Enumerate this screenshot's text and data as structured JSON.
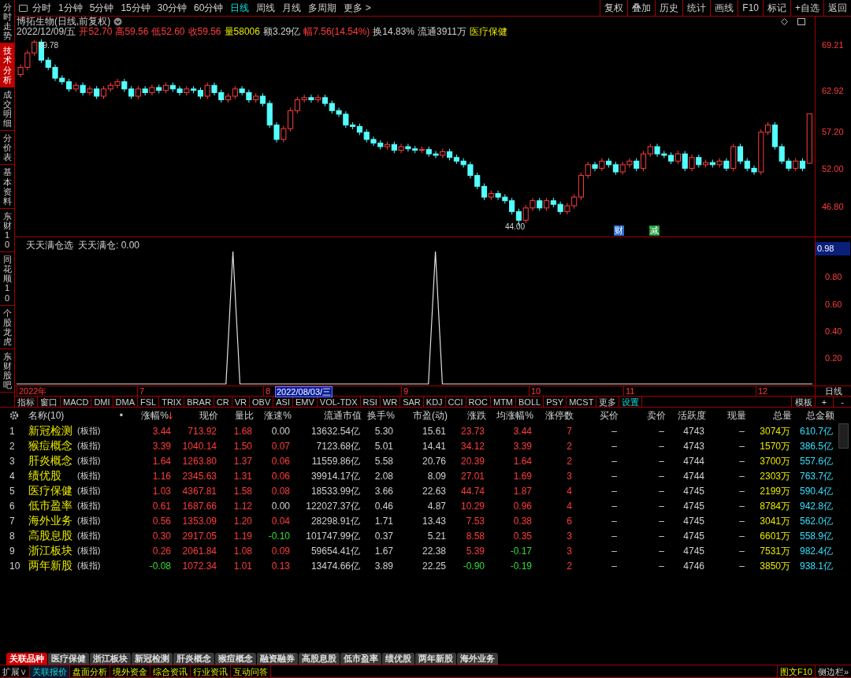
{
  "sidebar_tabs": [
    {
      "label": "分时走势",
      "selected": false
    },
    {
      "label": "技术分析",
      "selected": true
    },
    {
      "label": "成交明细",
      "selected": false
    },
    {
      "label": "分价表",
      "selected": false
    },
    {
      "label": "基本资料",
      "selected": false
    },
    {
      "label": "东财10",
      "selected": false
    },
    {
      "label": "同花顺10",
      "selected": false
    },
    {
      "label": "个股龙虎",
      "selected": false
    },
    {
      "label": "东财股吧",
      "selected": false
    }
  ],
  "periods": [
    {
      "label": "分时",
      "selected": false
    },
    {
      "label": "1分钟",
      "selected": false
    },
    {
      "label": "5分钟",
      "selected": false
    },
    {
      "label": "15分钟",
      "selected": false
    },
    {
      "label": "30分钟",
      "selected": false
    },
    {
      "label": "60分钟",
      "selected": false
    },
    {
      "label": "日线",
      "selected": true
    },
    {
      "label": "周线",
      "selected": false
    },
    {
      "label": "月线",
      "selected": false
    },
    {
      "label": "多周期",
      "selected": false
    }
  ],
  "more": "更多 >",
  "right_buttons": [
    "复权",
    "叠加",
    "历史",
    "统计",
    "画线",
    "F10",
    "标记",
    "+自选",
    "返回"
  ],
  "stock": {
    "title": "博拓生物(日线,前复权)",
    "info": [
      {
        "text": "2022/12/09/五",
        "kind": "plain"
      },
      {
        "text": "开52.70",
        "kind": "up"
      },
      {
        "text": "高59.56",
        "kind": "up"
      },
      {
        "text": "低52.60",
        "kind": "up"
      },
      {
        "text": "收59.56",
        "kind": "up"
      },
      {
        "text": "量58006",
        "kind": "volume"
      },
      {
        "text": "额3.29亿",
        "kind": "plain"
      },
      {
        "text": "幅7.56(14.54%)",
        "kind": "up"
      },
      {
        "text": "换14.83%",
        "kind": "plain"
      },
      {
        "text": "流通3911万",
        "kind": "plain"
      },
      {
        "text": "医疗保健",
        "kind": "volume"
      }
    ],
    "high_label": "69.78",
    "low_label": "44.00",
    "markers": [
      {
        "text": "财",
        "color": "#2f6fd0"
      },
      {
        "text": "减",
        "color": "#1f9a3a"
      }
    ],
    "chart_data": {
      "type": "candlestick",
      "yticks": [
        {
          "value": 69.21,
          "label": "69.21"
        },
        {
          "value": 62.92,
          "label": "62.92"
        },
        {
          "value": 57.2,
          "label": "57.20"
        },
        {
          "value": 52.0,
          "label": "52.00"
        },
        {
          "value": 46.8,
          "label": "46.80"
        }
      ],
      "ylim": [
        42.43,
        73.04
      ],
      "ohlc": [
        [
          65,
          66.4,
          64.6,
          66
        ],
        [
          66,
          68.4,
          65.6,
          68
        ],
        [
          68,
          69.78,
          67.6,
          69.5
        ],
        [
          69.5,
          69.9,
          66.6,
          67
        ],
        [
          67,
          67.4,
          65.6,
          66
        ],
        [
          66,
          66.4,
          64.1,
          64.5
        ],
        [
          64.5,
          64.9,
          63.6,
          64
        ],
        [
          64,
          64.4,
          62.6,
          63
        ],
        [
          63,
          63.9,
          62.6,
          63.5
        ],
        [
          63.5,
          63.9,
          62.1,
          62.5
        ],
        [
          62.5,
          63.4,
          62.1,
          63
        ],
        [
          63,
          63.4,
          61.6,
          62
        ],
        [
          62,
          63.4,
          61.6,
          63
        ],
        [
          63,
          63.9,
          62.6,
          63.5
        ],
        [
          63.5,
          64.4,
          63.1,
          64
        ],
        [
          64,
          64.4,
          62.6,
          63
        ],
        [
          63,
          63.4,
          61.6,
          62
        ],
        [
          62,
          63.4,
          61.6,
          63
        ],
        [
          63,
          63.4,
          62.1,
          62.5
        ],
        [
          62.5,
          63.6,
          62.1,
          63.2
        ],
        [
          63.2,
          63.6,
          62.4,
          62.8
        ],
        [
          62.8,
          63.9,
          62.4,
          63.5
        ],
        [
          63.5,
          63.9,
          62.6,
          63
        ],
        [
          63,
          63.4,
          62.1,
          62.5
        ],
        [
          62.5,
          63.4,
          62.1,
          63
        ],
        [
          63,
          63.4,
          62.4,
          62.8
        ],
        [
          62.8,
          63.2,
          61.6,
          62
        ],
        [
          62,
          63.9,
          61.6,
          63.5
        ],
        [
          63.5,
          63.9,
          62.1,
          62.5
        ],
        [
          62.5,
          62.9,
          61.1,
          61.5
        ],
        [
          61.5,
          62.4,
          61.1,
          62
        ],
        [
          62,
          63.4,
          61.6,
          63
        ],
        [
          63,
          63.4,
          62.1,
          62.5
        ],
        [
          62.5,
          62.9,
          61.1,
          61.5
        ],
        [
          61.5,
          62.4,
          61.1,
          62
        ],
        [
          62,
          62.4,
          60.6,
          61
        ],
        [
          61,
          61.4,
          57.6,
          58
        ],
        [
          58,
          58.4,
          55.6,
          56
        ],
        [
          56,
          57.9,
          55.6,
          57.5
        ],
        [
          57.5,
          60.4,
          57.1,
          60
        ],
        [
          60,
          61.9,
          59.6,
          61.5
        ],
        [
          61.5,
          62.2,
          61.1,
          61.8
        ],
        [
          61.8,
          62.2,
          61.1,
          61.5
        ],
        [
          61.5,
          62.2,
          61.1,
          61.8
        ],
        [
          61.8,
          62.2,
          60.6,
          61
        ],
        [
          61,
          61.4,
          59.6,
          60
        ],
        [
          60,
          60.4,
          59.1,
          59.5
        ],
        [
          59.5,
          59.9,
          57.6,
          58
        ],
        [
          58,
          58.4,
          57.4,
          57.8
        ],
        [
          57.8,
          58.2,
          56.6,
          57
        ],
        [
          57,
          57.4,
          55.6,
          56
        ],
        [
          56,
          56.4,
          55.1,
          55.5
        ],
        [
          55.5,
          55.9,
          54.6,
          55
        ],
        [
          55,
          55.7,
          54.6,
          55.3
        ],
        [
          55.3,
          55.7,
          54.1,
          54.5
        ],
        [
          54.5,
          55.4,
          54.1,
          55
        ],
        [
          55,
          55.4,
          54.3,
          54.7
        ],
        [
          54.7,
          55.1,
          54.1,
          54.5
        ],
        [
          54.5,
          55,
          54.1,
          54.6
        ],
        [
          54.6,
          55,
          53.6,
          54
        ],
        [
          54,
          54.4,
          53.4,
          53.8
        ],
        [
          53.8,
          54.7,
          53.4,
          54.3
        ],
        [
          54.3,
          54.7,
          53.1,
          53.5
        ],
        [
          53.5,
          53.9,
          52.6,
          53
        ],
        [
          53,
          53.4,
          52.1,
          52.5
        ],
        [
          52.5,
          52.9,
          50.6,
          51
        ],
        [
          51,
          51.4,
          49.1,
          49.5
        ],
        [
          49.5,
          49.9,
          47.6,
          48
        ],
        [
          48,
          48.9,
          47.6,
          48.5
        ],
        [
          48.5,
          48.9,
          47.6,
          48
        ],
        [
          48,
          48.4,
          47.1,
          47.5
        ],
        [
          47.5,
          47.9,
          45.6,
          46
        ],
        [
          46,
          46.4,
          44,
          44.8
        ],
        [
          44.8,
          46.9,
          44.4,
          46.5
        ],
        [
          46.5,
          47.9,
          46.1,
          47.5
        ],
        [
          47.5,
          47.9,
          46.1,
          46.5
        ],
        [
          46.5,
          47.9,
          46.1,
          47.5
        ],
        [
          47.5,
          47.9,
          46.6,
          47
        ],
        [
          47,
          47.4,
          45.6,
          46
        ],
        [
          46,
          47.2,
          45.6,
          46.8
        ],
        [
          46.8,
          48.4,
          46.4,
          48
        ],
        [
          48,
          51.4,
          47.6,
          51
        ],
        [
          51,
          52.9,
          50.6,
          52.5
        ],
        [
          52.5,
          52.9,
          51.6,
          52
        ],
        [
          52,
          53.4,
          51.6,
          53
        ],
        [
          53,
          53.4,
          52.1,
          52.5
        ],
        [
          52.5,
          52.9,
          51.1,
          51.5
        ],
        [
          51.5,
          52.9,
          51.1,
          52.5
        ],
        [
          52.5,
          53.4,
          52.1,
          53
        ],
        [
          53,
          53.4,
          51.6,
          52
        ],
        [
          52,
          54.4,
          51.6,
          54
        ],
        [
          54,
          55.4,
          53.6,
          55
        ],
        [
          55,
          55.4,
          53.6,
          54
        ],
        [
          54,
          54.4,
          53.4,
          53.8
        ],
        [
          53.8,
          54.2,
          52.6,
          53
        ],
        [
          53,
          54.4,
          52.6,
          54
        ],
        [
          54,
          54.4,
          51.6,
          52
        ],
        [
          52,
          53.9,
          51.6,
          53.5
        ],
        [
          53.5,
          53.9,
          52.1,
          52.5
        ],
        [
          52.5,
          53.2,
          52.1,
          52.8
        ],
        [
          52.8,
          53.2,
          52.1,
          52.5
        ],
        [
          52.5,
          53.4,
          52.1,
          53
        ],
        [
          53,
          53.4,
          51.6,
          52
        ],
        [
          52,
          55.4,
          51.6,
          55
        ],
        [
          55,
          55.4,
          52.6,
          53
        ],
        [
          53,
          53.4,
          51.6,
          52
        ],
        [
          52,
          52.4,
          51.1,
          51.5
        ],
        [
          51.5,
          57.4,
          51.1,
          57
        ],
        [
          57,
          58.4,
          56.6,
          58
        ],
        [
          58,
          58.4,
          54.6,
          55
        ],
        [
          55,
          55.4,
          52.6,
          53
        ],
        [
          53,
          53.4,
          51.6,
          52
        ],
        [
          52,
          53.4,
          51.6,
          53
        ],
        [
          53,
          53.4,
          51.6,
          52
        ],
        [
          52.7,
          59.56,
          52.6,
          59.56
        ]
      ]
    }
  },
  "indicator": {
    "title": "天天满仓选",
    "value": "天天满仓: 0.00",
    "current": "0.98",
    "chart_data": {
      "type": "line",
      "ylim": [
        -0.0175,
        1.085
      ],
      "yticks": [
        {
          "value": 0.2,
          "label": "0.20"
        },
        {
          "value": 0.4,
          "label": "0.40"
        },
        {
          "value": 0.6,
          "label": "0.60"
        },
        {
          "value": 0.8,
          "label": "0.80"
        }
      ],
      "series": [
        {
          "color": "#e0e0e0",
          "values": [
            0,
            0,
            0,
            0,
            0,
            0,
            0,
            0,
            0,
            0,
            0,
            0,
            0,
            0,
            0,
            0,
            0,
            0,
            0,
            0,
            0,
            0,
            0,
            0,
            0,
            0,
            0,
            0,
            0,
            0,
            0,
            0.98,
            0,
            0,
            0,
            0,
            0,
            0,
            0,
            0,
            0,
            0,
            0,
            0,
            0,
            0,
            0,
            0,
            0,
            0,
            0,
            0,
            0,
            0,
            0,
            0,
            0,
            0,
            0,
            0,
            0.98,
            0,
            0,
            0,
            0,
            0,
            0,
            0,
            0,
            0,
            0,
            0,
            0,
            0,
            0,
            0,
            0,
            0,
            0,
            0,
            0,
            0,
            0,
            0,
            0,
            0,
            0,
            0,
            0,
            0,
            0,
            0,
            0,
            0,
            0,
            0,
            0,
            0,
            0,
            0,
            0,
            0,
            0,
            0,
            0,
            0,
            0,
            0,
            0,
            0,
            0,
            0,
            0,
            0,
            0
          ]
        }
      ]
    }
  },
  "date_axis": [
    {
      "label": "2022年",
      "selected": false
    },
    {
      "label": "7",
      "selected": false
    },
    {
      "label": "8",
      "selected": false
    },
    {
      "label": "2022/08/03/三",
      "selected": true
    },
    {
      "label": "9",
      "selected": false
    },
    {
      "label": "10",
      "selected": false
    },
    {
      "label": "11",
      "selected": false
    },
    {
      "label": "12",
      "selected": false
    }
  ],
  "period_label": "日线",
  "indicator_tabs": [
    {
      "label": "指标",
      "kind": "plain"
    },
    {
      "label": "窗口",
      "kind": "plain"
    },
    {
      "label": "MACD",
      "kind": "plain"
    },
    {
      "label": "DMI",
      "kind": "plain"
    },
    {
      "label": "DMA",
      "kind": "plain"
    },
    {
      "label": "FSL",
      "kind": "plain"
    },
    {
      "label": "TRIX",
      "kind": "plain"
    },
    {
      "label": "BRAR",
      "kind": "plain"
    },
    {
      "label": "CR",
      "kind": "plain"
    },
    {
      "label": "VR",
      "kind": "plain"
    },
    {
      "label": "OBV",
      "kind": "plain"
    },
    {
      "label": "ASI",
      "kind": "plain"
    },
    {
      "label": "EMV",
      "kind": "plain"
    },
    {
      "label": "VOL-TDX",
      "kind": "plain"
    },
    {
      "label": "RSI",
      "kind": "plain"
    },
    {
      "label": "WR",
      "kind": "plain"
    },
    {
      "label": "SAR",
      "kind": "plain"
    },
    {
      "label": "KDJ",
      "kind": "plain"
    },
    {
      "label": "CCI",
      "kind": "plain"
    },
    {
      "label": "ROC",
      "kind": "plain"
    },
    {
      "label": "MTM",
      "kind": "plain"
    },
    {
      "label": "BOLL",
      "kind": "plain"
    },
    {
      "label": "PSY",
      "kind": "plain"
    },
    {
      "label": "MCST",
      "kind": "plain"
    },
    {
      "label": "更多",
      "kind": "plain"
    },
    {
      "label": "设置",
      "kind": "link"
    }
  ],
  "template_buttons": [
    "模板",
    "+",
    "-"
  ],
  "table": {
    "name_marker": "•",
    "columns": [
      "名称(10)",
      "涨幅%",
      "现价",
      "量比",
      "涨速%",
      "流通市值",
      "换手%",
      "市盈(动)",
      "涨跌",
      "均涨幅%",
      "涨停数",
      "买价",
      "卖价",
      "活跃度",
      "现量",
      "总量",
      "总金额"
    ],
    "rows": [
      {
        "index": "1",
        "cells": [
          {
            "text": "新冠检测",
            "tag": "(板指)",
            "kind": "name"
          },
          {
            "text": "3.44",
            "kind": "up"
          },
          {
            "text": "713.92",
            "kind": "up"
          },
          {
            "text": "1.68",
            "kind": "up"
          },
          {
            "text": "0.00",
            "kind": "plain"
          },
          {
            "text": "13632.54亿",
            "kind": "plain"
          },
          {
            "text": "5.30",
            "kind": "plain"
          },
          {
            "text": "15.61",
            "kind": "plain"
          },
          {
            "text": "23.73",
            "kind": "up"
          },
          {
            "text": "3.44",
            "kind": "up"
          },
          {
            "text": "7",
            "kind": "up"
          },
          {
            "text": "–",
            "kind": "plain"
          },
          {
            "text": "–",
            "kind": "plain"
          },
          {
            "text": "4743",
            "kind": "plain"
          },
          {
            "text": "–",
            "kind": "plain"
          },
          {
            "text": "3074万",
            "kind": "volume"
          },
          {
            "text": "610.7亿",
            "kind": "amount"
          }
        ]
      },
      {
        "index": "2",
        "cells": [
          {
            "text": "猴痘概念",
            "tag": "(板指)",
            "kind": "name"
          },
          {
            "text": "3.39",
            "kind": "up"
          },
          {
            "text": "1040.14",
            "kind": "up"
          },
          {
            "text": "1.50",
            "kind": "up"
          },
          {
            "text": "0.07",
            "kind": "up"
          },
          {
            "text": "7123.68亿",
            "kind": "plain"
          },
          {
            "text": "5.01",
            "kind": "plain"
          },
          {
            "text": "14.41",
            "kind": "plain"
          },
          {
            "text": "34.12",
            "kind": "up"
          },
          {
            "text": "3.39",
            "kind": "up"
          },
          {
            "text": "2",
            "kind": "up"
          },
          {
            "text": "–",
            "kind": "plain"
          },
          {
            "text": "–",
            "kind": "plain"
          },
          {
            "text": "4743",
            "kind": "plain"
          },
          {
            "text": "–",
            "kind": "plain"
          },
          {
            "text": "1570万",
            "kind": "volume"
          },
          {
            "text": "386.5亿",
            "kind": "amount"
          }
        ]
      },
      {
        "index": "3",
        "cells": [
          {
            "text": "肝炎概念",
            "tag": "(板指)",
            "kind": "name"
          },
          {
            "text": "1.64",
            "kind": "up"
          },
          {
            "text": "1263.80",
            "kind": "up"
          },
          {
            "text": "1.37",
            "kind": "up"
          },
          {
            "text": "0.06",
            "kind": "up"
          },
          {
            "text": "11559.86亿",
            "kind": "plain"
          },
          {
            "text": "5.58",
            "kind": "plain"
          },
          {
            "text": "20.76",
            "kind": "plain"
          },
          {
            "text": "20.39",
            "kind": "up"
          },
          {
            "text": "1.64",
            "kind": "up"
          },
          {
            "text": "2",
            "kind": "up"
          },
          {
            "text": "–",
            "kind": "plain"
          },
          {
            "text": "–",
            "kind": "plain"
          },
          {
            "text": "4744",
            "kind": "plain"
          },
          {
            "text": "–",
            "kind": "plain"
          },
          {
            "text": "3700万",
            "kind": "volume"
          },
          {
            "text": "557.6亿",
            "kind": "amount"
          }
        ]
      },
      {
        "index": "4",
        "cells": [
          {
            "text": "绩优股",
            "tag": "(板指)",
            "kind": "name"
          },
          {
            "text": "1.16",
            "kind": "up"
          },
          {
            "text": "2345.63",
            "kind": "up"
          },
          {
            "text": "1.31",
            "kind": "up"
          },
          {
            "text": "0.06",
            "kind": "up"
          },
          {
            "text": "39914.17亿",
            "kind": "plain"
          },
          {
            "text": "2.08",
            "kind": "plain"
          },
          {
            "text": "8.09",
            "kind": "plain"
          },
          {
            "text": "27.01",
            "kind": "up"
          },
          {
            "text": "1.69",
            "kind": "up"
          },
          {
            "text": "3",
            "kind": "up"
          },
          {
            "text": "–",
            "kind": "plain"
          },
          {
            "text": "–",
            "kind": "plain"
          },
          {
            "text": "4744",
            "kind": "plain"
          },
          {
            "text": "–",
            "kind": "plain"
          },
          {
            "text": "2303万",
            "kind": "volume"
          },
          {
            "text": "763.7亿",
            "kind": "amount"
          }
        ]
      },
      {
        "index": "5",
        "cells": [
          {
            "text": "医疗保健",
            "tag": "(板指)",
            "kind": "name"
          },
          {
            "text": "1.03",
            "kind": "up"
          },
          {
            "text": "4367.81",
            "kind": "up"
          },
          {
            "text": "1.58",
            "kind": "up"
          },
          {
            "text": "0.08",
            "kind": "up"
          },
          {
            "text": "18533.99亿",
            "kind": "plain"
          },
          {
            "text": "3.66",
            "kind": "plain"
          },
          {
            "text": "22.63",
            "kind": "plain"
          },
          {
            "text": "44.74",
            "kind": "up"
          },
          {
            "text": "1.87",
            "kind": "up"
          },
          {
            "text": "4",
            "kind": "up"
          },
          {
            "text": "–",
            "kind": "plain"
          },
          {
            "text": "–",
            "kind": "plain"
          },
          {
            "text": "4745",
            "kind": "plain"
          },
          {
            "text": "–",
            "kind": "plain"
          },
          {
            "text": "2199万",
            "kind": "volume"
          },
          {
            "text": "590.4亿",
            "kind": "amount"
          }
        ]
      },
      {
        "index": "6",
        "cells": [
          {
            "text": "低市盈率",
            "tag": "(板指)",
            "kind": "name"
          },
          {
            "text": "0.61",
            "kind": "up"
          },
          {
            "text": "1687.66",
            "kind": "up"
          },
          {
            "text": "1.12",
            "kind": "up"
          },
          {
            "text": "0.00",
            "kind": "plain"
          },
          {
            "text": "122027.37亿",
            "kind": "plain"
          },
          {
            "text": "0.46",
            "kind": "plain"
          },
          {
            "text": "4.87",
            "kind": "plain"
          },
          {
            "text": "10.29",
            "kind": "up"
          },
          {
            "text": "0.96",
            "kind": "up"
          },
          {
            "text": "4",
            "kind": "up"
          },
          {
            "text": "–",
            "kind": "plain"
          },
          {
            "text": "–",
            "kind": "plain"
          },
          {
            "text": "4745",
            "kind": "plain"
          },
          {
            "text": "–",
            "kind": "plain"
          },
          {
            "text": "8784万",
            "kind": "volume"
          },
          {
            "text": "942.8亿",
            "kind": "amount"
          }
        ]
      },
      {
        "index": "7",
        "cells": [
          {
            "text": "海外业务",
            "tag": "(板指)",
            "kind": "name"
          },
          {
            "text": "0.56",
            "kind": "up"
          },
          {
            "text": "1353.09",
            "kind": "up"
          },
          {
            "text": "1.20",
            "kind": "up"
          },
          {
            "text": "0.04",
            "kind": "up"
          },
          {
            "text": "28298.91亿",
            "kind": "plain"
          },
          {
            "text": "1.71",
            "kind": "plain"
          },
          {
            "text": "13.43",
            "kind": "plain"
          },
          {
            "text": "7.53",
            "kind": "up"
          },
          {
            "text": "0.38",
            "kind": "up"
          },
          {
            "text": "6",
            "kind": "up"
          },
          {
            "text": "–",
            "kind": "plain"
          },
          {
            "text": "–",
            "kind": "plain"
          },
          {
            "text": "4745",
            "kind": "plain"
          },
          {
            "text": "–",
            "kind": "plain"
          },
          {
            "text": "3041万",
            "kind": "volume"
          },
          {
            "text": "562.0亿",
            "kind": "amount"
          }
        ]
      },
      {
        "index": "8",
        "cells": [
          {
            "text": "高股息股",
            "tag": "(板指)",
            "kind": "name"
          },
          {
            "text": "0.30",
            "kind": "up"
          },
          {
            "text": "2917.05",
            "kind": "up"
          },
          {
            "text": "1.19",
            "kind": "up"
          },
          {
            "text": "-0.10",
            "kind": "down"
          },
          {
            "text": "101747.99亿",
            "kind": "plain"
          },
          {
            "text": "0.37",
            "kind": "plain"
          },
          {
            "text": "5.21",
            "kind": "plain"
          },
          {
            "text": "8.58",
            "kind": "up"
          },
          {
            "text": "0.35",
            "kind": "up"
          },
          {
            "text": "3",
            "kind": "up"
          },
          {
            "text": "–",
            "kind": "plain"
          },
          {
            "text": "–",
            "kind": "plain"
          },
          {
            "text": "4745",
            "kind": "plain"
          },
          {
            "text": "–",
            "kind": "plain"
          },
          {
            "text": "6601万",
            "kind": "volume"
          },
          {
            "text": "558.9亿",
            "kind": "amount"
          }
        ]
      },
      {
        "index": "9",
        "cells": [
          {
            "text": "浙江板块",
            "tag": "(板指)",
            "kind": "name"
          },
          {
            "text": "0.26",
            "kind": "up"
          },
          {
            "text": "2061.84",
            "kind": "up"
          },
          {
            "text": "1.08",
            "kind": "up"
          },
          {
            "text": "0.09",
            "kind": "up"
          },
          {
            "text": "59654.41亿",
            "kind": "plain"
          },
          {
            "text": "1.67",
            "kind": "plain"
          },
          {
            "text": "22.38",
            "kind": "plain"
          },
          {
            "text": "5.39",
            "kind": "up"
          },
          {
            "text": "-0.17",
            "kind": "down"
          },
          {
            "text": "3",
            "kind": "up"
          },
          {
            "text": "–",
            "kind": "plain"
          },
          {
            "text": "–",
            "kind": "plain"
          },
          {
            "text": "4745",
            "kind": "plain"
          },
          {
            "text": "–",
            "kind": "plain"
          },
          {
            "text": "7531万",
            "kind": "volume"
          },
          {
            "text": "982.4亿",
            "kind": "amount"
          }
        ]
      },
      {
        "index": "10",
        "cells": [
          {
            "text": "两年新股",
            "tag": "(板指)",
            "kind": "name"
          },
          {
            "text": "-0.08",
            "kind": "down"
          },
          {
            "text": "1072.34",
            "kind": "up"
          },
          {
            "text": "1.01",
            "kind": "up"
          },
          {
            "text": "0.13",
            "kind": "up"
          },
          {
            "text": "13474.66亿",
            "kind": "plain"
          },
          {
            "text": "3.89",
            "kind": "plain"
          },
          {
            "text": "22.25",
            "kind": "plain"
          },
          {
            "text": "-0.90",
            "kind": "down"
          },
          {
            "text": "-0.19",
            "kind": "down"
          },
          {
            "text": "2",
            "kind": "up"
          },
          {
            "text": "–",
            "kind": "plain"
          },
          {
            "text": "–",
            "kind": "plain"
          },
          {
            "text": "4746",
            "kind": "plain"
          },
          {
            "text": "–",
            "kind": "plain"
          },
          {
            "text": "3850万",
            "kind": "volume"
          },
          {
            "text": "938.1亿",
            "kind": "amount"
          }
        ]
      }
    ]
  },
  "sector_tabs": [
    {
      "label": "关联品种",
      "selected": true
    },
    {
      "label": "医疗保健",
      "selected": false
    },
    {
      "label": "浙江板块",
      "selected": false
    },
    {
      "label": "新冠检测",
      "selected": false
    },
    {
      "label": "肝炎概念",
      "selected": false
    },
    {
      "label": "猴痘概念",
      "selected": false
    },
    {
      "label": "融资融券",
      "selected": false
    },
    {
      "label": "高股息股",
      "selected": false
    },
    {
      "label": "低市盈率",
      "selected": false
    },
    {
      "label": "绩优股",
      "selected": false
    },
    {
      "label": "两年新股",
      "selected": false
    },
    {
      "label": "海外业务",
      "selected": false
    }
  ],
  "bottom_tabs": [
    {
      "label": "扩展∨",
      "kind": "plain",
      "selected": false
    },
    {
      "label": "关联报价",
      "selected": true
    },
    {
      "label": "盘面分析",
      "kind": "link",
      "selected": false
    },
    {
      "label": "境外资金",
      "kind": "link",
      "selected": false
    },
    {
      "label": "综合资讯",
      "kind": "link",
      "selected": false
    },
    {
      "label": "行业资讯",
      "kind": "link",
      "selected": false
    },
    {
      "label": "互动问答",
      "kind": "link",
      "selected": false
    }
  ],
  "bottom_right": [
    {
      "label": "图文F10",
      "kind": "link"
    },
    {
      "label": "侧边栏»",
      "kind": "plain"
    }
  ]
}
